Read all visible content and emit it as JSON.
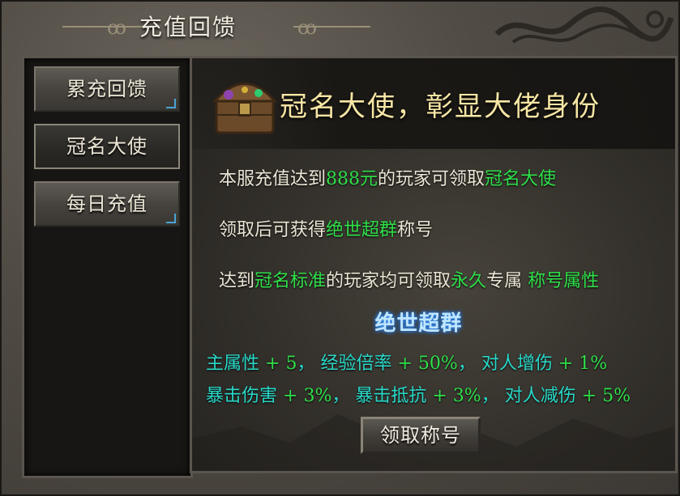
{
  "window": {
    "title": "充值回馈",
    "accent_color": "#f7e6a4",
    "highlight_color": "#2fe04a",
    "stat_color": "#28d9c9"
  },
  "sidebar": {
    "items": [
      {
        "label": "累充回馈",
        "active": false
      },
      {
        "label": "冠名大使",
        "active": true
      },
      {
        "label": "每日充值",
        "active": false
      }
    ]
  },
  "banner": {
    "title": "冠名大使，彰显大佬身份",
    "icon": "treasure-chest-icon"
  },
  "description": {
    "line1": {
      "prefix": "本服充值达到",
      "amount": "888元",
      "middle": "的玩家可领取",
      "reward": "冠名大使"
    },
    "line2": {
      "prefix": "领取后可获得",
      "title": "绝世超群",
      "suffix": "称号"
    },
    "line3": {
      "prefix": "达到",
      "standard": "冠名标准",
      "middle": "的玩家均可领取",
      "permanent": "永久",
      "middle2": "专属",
      "attr": "称号属性"
    }
  },
  "title_badge": {
    "text": "绝世超群"
  },
  "stats": {
    "row1": [
      {
        "name": "主属性",
        "value": "+ 5",
        "sep": "，"
      },
      {
        "name": "经验倍率",
        "value": "+ 50%",
        "sep": "，"
      },
      {
        "name": "对人增伤",
        "value": "+ 1%",
        "sep": ""
      }
    ],
    "row2": [
      {
        "name": "暴击伤害",
        "value": "+ 3%",
        "sep": "，"
      },
      {
        "name": "暴击抵抗",
        "value": "+ 3%",
        "sep": "，"
      },
      {
        "name": "对人减伤",
        "value": "+ 5%",
        "sep": ""
      }
    ]
  },
  "actions": {
    "claim_label": "领取称号"
  }
}
